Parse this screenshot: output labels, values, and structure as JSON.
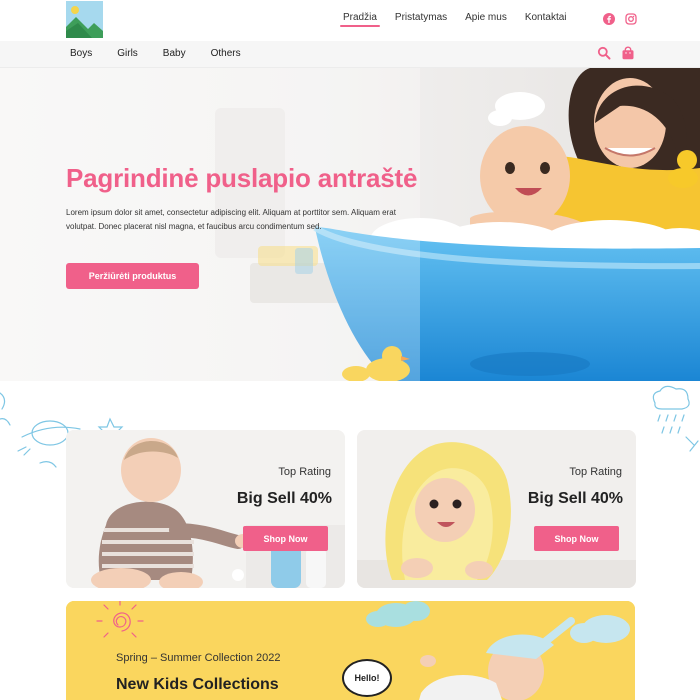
{
  "header": {
    "logo_icon": "image-placeholder-icon",
    "nav": [
      "Pradžia",
      "Pristatymas",
      "Apie mus",
      "Kontaktai"
    ],
    "active_nav": "Pradžia",
    "social_icons": [
      "facebook-icon",
      "instagram-icon"
    ]
  },
  "categories": [
    "Boys",
    "Girls",
    "Baby",
    "Others"
  ],
  "shop_icons": [
    "search-icon",
    "shopping-bag-icon"
  ],
  "hero": {
    "title": "Pagrindinė puslapio antraštė",
    "text": "Lorem ipsum dolor sit amet, consectetur adipiscing elit. Aliquam at porttitor sem. Aliquam erat volutpat. Donec placerat nisl magna, et faucibus arcu condimentum sed.",
    "button": "Peržiūrėti produktus"
  },
  "cards": [
    {
      "subtitle": "Top Rating",
      "title": "Big Sell 40%",
      "button": "Shop Now"
    },
    {
      "subtitle": "Top Rating",
      "title": "Big Sell 40%",
      "button": "Shop Now"
    }
  ],
  "banner": {
    "subtitle": "Spring – Summer Collection 2022",
    "title": "New Kids Collections",
    "bubble": "Hello!"
  },
  "colors": {
    "accent": "#f0608a",
    "banner_bg": "#fad65e",
    "tub_blue": "#3aa8e8",
    "doodle_blue": "#7ec6e4"
  }
}
